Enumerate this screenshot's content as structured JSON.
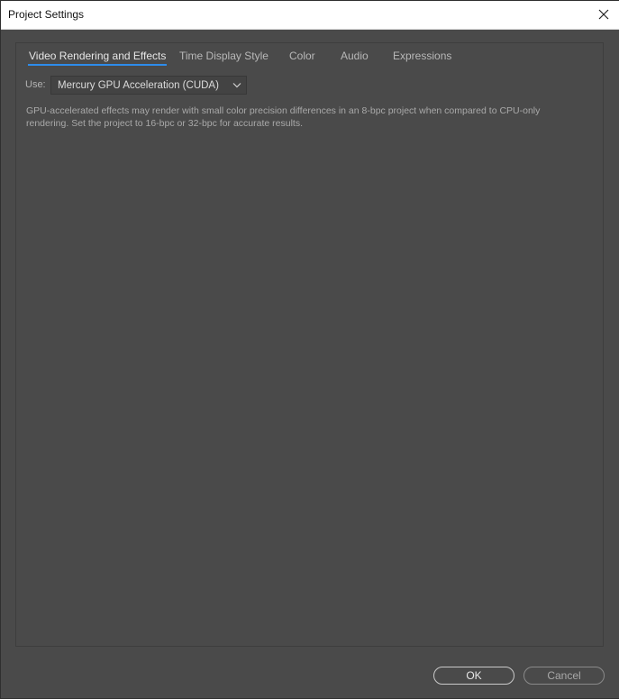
{
  "window": {
    "title": "Project Settings"
  },
  "tabs": [
    {
      "label": "Video Rendering and Effects",
      "active": true
    },
    {
      "label": "Time Display Style",
      "active": false
    },
    {
      "label": "Color",
      "active": false
    },
    {
      "label": "Audio",
      "active": false
    },
    {
      "label": "Expressions",
      "active": false
    }
  ],
  "video": {
    "use_label": "Use:",
    "renderer_selected": "Mercury GPU Acceleration (CUDA)",
    "info_text": "GPU-accelerated effects may render with small color precision differences in an 8-bpc project when compared to CPU-only rendering. Set the project to 16-bpc or 32-bpc for accurate results."
  },
  "footer": {
    "ok_label": "OK",
    "cancel_label": "Cancel"
  },
  "colors": {
    "accent": "#2d8ceb",
    "background": "#4a4a4a"
  },
  "icons": {
    "close": "close-icon",
    "dropdown": "chevron-down-icon"
  }
}
